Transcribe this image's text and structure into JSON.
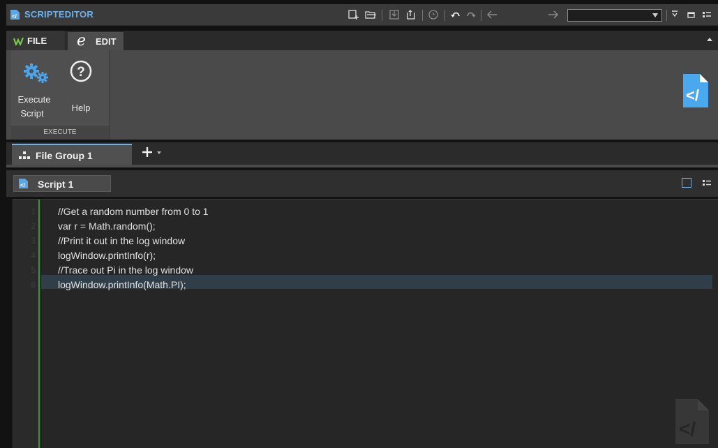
{
  "titlebar": {
    "title": "SCRIPTEDITOR",
    "icons": [
      "new-file-icon",
      "open-folder-icon",
      "save-icon",
      "save-as-icon",
      "restore-icon",
      "undo-icon",
      "redo-icon",
      "back-arrow-icon",
      "forward-arrow-icon",
      "window-menu-icon",
      "maximize-icon",
      "settings-list-icon"
    ],
    "combo_value": ""
  },
  "ribbon": {
    "tabs": [
      {
        "label": "FILE",
        "icon": "wavelab-logo-icon"
      },
      {
        "label": "EDIT",
        "icon": "edit-e-icon"
      }
    ],
    "buttons": {
      "execute_line1": "Execute",
      "execute_line2": "Script",
      "help": "Help"
    },
    "group_label": "EXECUTE"
  },
  "file_group": {
    "tab_label": "File Group 1",
    "add_icon": "plus-icon"
  },
  "script_tab": {
    "label": "Script 1"
  },
  "editor": {
    "line_numbers": [
      "1",
      "2",
      "3",
      "4",
      "5",
      "6"
    ],
    "lines": [
      "//Get a random number from 0 to 1",
      "var r = Math.random();",
      "//Print it out in the log window",
      "logWindow.printInfo(r);",
      "//Trace out Pi in the log window",
      "logWindow.printInfo(Math.PI);"
    ]
  },
  "colors": {
    "accent": "#6fb2ea",
    "gutter_bar": "#2aa12a",
    "current_line": "#2f3e49"
  }
}
